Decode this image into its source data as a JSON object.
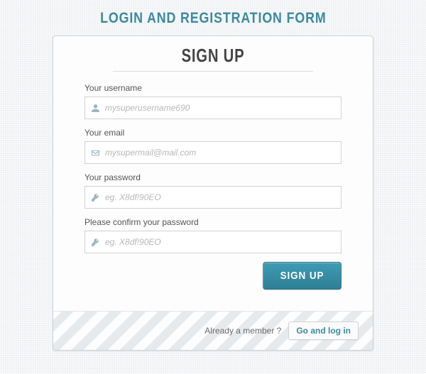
{
  "page": {
    "title": "LOGIN AND REGISTRATION FORM"
  },
  "form": {
    "title": "Sign up",
    "fields": {
      "username": {
        "label": "Your username",
        "placeholder": "mysuperusername690"
      },
      "email": {
        "label": "Your email",
        "placeholder": "mysupermail@mail.com"
      },
      "password": {
        "label": "Your password",
        "placeholder": "eg. X8df!90EO"
      },
      "confirm": {
        "label": "Please confirm your password",
        "placeholder": "eg. X8df!90EO"
      }
    },
    "submit_label": "SIGN UP"
  },
  "footer": {
    "prompt": "Already a member ?",
    "link_label": "Go and log in"
  }
}
